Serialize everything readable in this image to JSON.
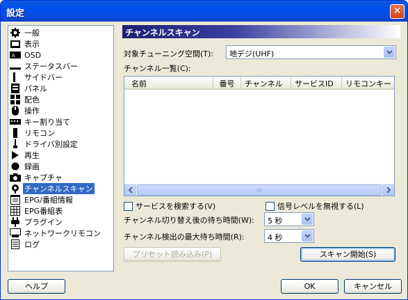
{
  "window": {
    "title": "設定",
    "close_glyph": "✕"
  },
  "tree": {
    "items": [
      {
        "label": "一般",
        "icon": "gear-icon"
      },
      {
        "label": "表示",
        "icon": "display-icon"
      },
      {
        "label": "OSD",
        "icon": "osd-icon"
      },
      {
        "label": "ステータスバー",
        "icon": "statusbar-icon"
      },
      {
        "label": "サイドバー",
        "icon": "sidebar-icon"
      },
      {
        "label": "パネル",
        "icon": "panel-icon"
      },
      {
        "label": "配色",
        "icon": "palette-icon"
      },
      {
        "label": "操作",
        "icon": "mouse-icon"
      },
      {
        "label": "キー割り当て",
        "icon": "keyboard-icon"
      },
      {
        "label": "リモコン",
        "icon": "remote-icon"
      },
      {
        "label": "ドライバ別設定",
        "icon": "driver-icon"
      },
      {
        "label": "再生",
        "icon": "play-icon"
      },
      {
        "label": "録画",
        "icon": "record-icon"
      },
      {
        "label": "キャプチャ",
        "icon": "camera-icon"
      },
      {
        "label": "チャンネルスキャン",
        "icon": "antenna-icon",
        "selected": true
      },
      {
        "label": "EPG/番組情報",
        "icon": "epg-icon"
      },
      {
        "label": "EPG番組表",
        "icon": "epg-table-icon"
      },
      {
        "label": "プラグイン",
        "icon": "plugin-icon"
      },
      {
        "label": "ネットワークリモコン",
        "icon": "network-icon"
      },
      {
        "label": "ログ",
        "icon": "log-icon"
      }
    ]
  },
  "panel": {
    "header": "チャンネルスキャン",
    "space_label": "対象チューニング空間(T):",
    "space_value": "地デジ(UHF)",
    "list_label": "チャンネル一覧(C):",
    "columns": [
      "名前",
      "番号",
      "チャンネル",
      "サービスID",
      "リモコンキー"
    ],
    "search_services_label": "サービスを検索する(V)",
    "ignore_signal_label": "信号レベルを無視する(L)",
    "switch_wait_label": "チャンネル切り替え後の待ち時間(W):",
    "switch_wait_value": "5 秒",
    "max_wait_label": "チャンネル検出の最大待ち時間(R):",
    "max_wait_value": "4 秒",
    "preset_button": "プリセット読み込み(P)",
    "scan_button": "スキャン開始(S)"
  },
  "footer": {
    "help": "ヘルプ",
    "ok": "OK",
    "cancel": "キャンセル"
  },
  "colors": {
    "accent": "#316ac5",
    "header_dark": "#1d2173",
    "title_blue": "#0050ee"
  }
}
